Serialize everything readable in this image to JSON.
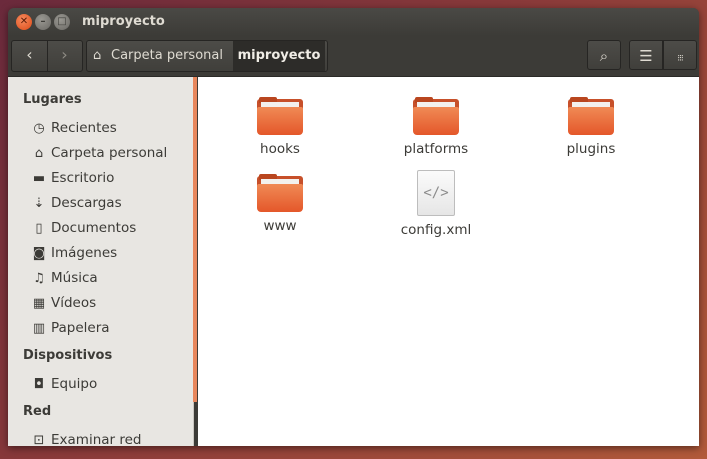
{
  "window": {
    "title": "miproyecto"
  },
  "toolbar": {
    "back_icon": "‹",
    "forward_icon": "›",
    "breadcrumb": {
      "home_label": "Carpeta personal",
      "current_label": "miproyecto"
    },
    "search_icon": "⌕",
    "list_icon": "☰",
    "grid_icon": "⁝⁝⁝"
  },
  "sidebar": {
    "places_header": "Lugares",
    "places": [
      {
        "label": "Recientes",
        "icon": "clock-icon",
        "glyph": "◷"
      },
      {
        "label": "Carpeta personal",
        "icon": "home-icon",
        "glyph": "⌂"
      },
      {
        "label": "Escritorio",
        "icon": "desktop-folder-icon",
        "glyph": "▬"
      },
      {
        "label": "Descargas",
        "icon": "download-icon",
        "glyph": "⇣"
      },
      {
        "label": "Documentos",
        "icon": "document-icon",
        "glyph": "▯"
      },
      {
        "label": "Imágenes",
        "icon": "camera-icon",
        "glyph": "◙"
      },
      {
        "label": "Música",
        "icon": "music-icon",
        "glyph": "♫"
      },
      {
        "label": "Vídeos",
        "icon": "film-icon",
        "glyph": "▦"
      },
      {
        "label": "Papelera",
        "icon": "trash-icon",
        "glyph": "▥"
      }
    ],
    "devices_header": "Dispositivos",
    "devices": [
      {
        "label": "Equipo",
        "icon": "drive-icon",
        "glyph": "◘"
      }
    ],
    "network_header": "Red",
    "network": [
      {
        "label": "Examinar red",
        "icon": "network-icon",
        "glyph": "⊡"
      }
    ]
  },
  "files": [
    {
      "name": "hooks",
      "type": "folder"
    },
    {
      "name": "platforms",
      "type": "folder"
    },
    {
      "name": "plugins",
      "type": "folder"
    },
    {
      "name": "www",
      "type": "folder"
    },
    {
      "name": "config.xml",
      "type": "xml-file",
      "glyph": "</>"
    }
  ],
  "colors": {
    "accent": "#e8875d",
    "folder": "#e4572a",
    "titlebar": "#3c3b37"
  }
}
